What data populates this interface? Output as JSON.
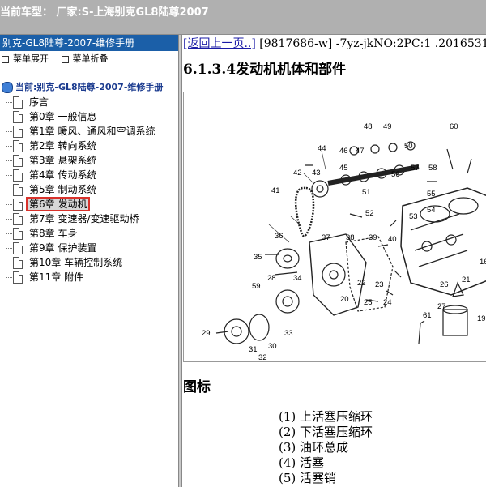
{
  "header": {
    "title": "当前车型：  厂家:S-上海别克GL8陆尊2007"
  },
  "left": {
    "bar_title": "别克-GL8陆尊-2007-维修手册",
    "tools": {
      "expand": "菜单展开",
      "collapse": "菜单折叠"
    },
    "root_label": "当前:别克-GL8陆尊-2007-维修手册",
    "items": [
      {
        "label": "序言"
      },
      {
        "label": "第0章 一般信息"
      },
      {
        "label": "第1章 暖风、通风和空调系统"
      },
      {
        "label": "第2章 转向系统"
      },
      {
        "label": "第3章 悬架系统"
      },
      {
        "label": "第4章 传动系统"
      },
      {
        "label": "第5章 制动系统"
      },
      {
        "label": "第6章 发动机"
      },
      {
        "label": "第7章 变速器/变速驱动桥"
      },
      {
        "label": "第8章 车身"
      },
      {
        "label": "第9章 保护装置"
      },
      {
        "label": "第10章 车辆控制系统"
      },
      {
        "label": "第11章 附件"
      }
    ],
    "selected_index": 7
  },
  "right": {
    "back_link": "[返回上一页..]",
    "nav_info": " [9817686-w] -7yz-jkNO:2PC:1 .20165311",
    "heading": "6.1.3.4发动机机体和部件",
    "figure_callouts": [
      "48",
      "49",
      "60",
      "46",
      "47",
      "50",
      "44",
      "45",
      "58",
      "57",
      "56",
      "42",
      "43",
      "41",
      "51",
      "55",
      "54",
      "52",
      "53",
      "36",
      "37",
      "38",
      "39",
      "40",
      "35",
      "16",
      "28",
      "34",
      "21",
      "22",
      "23",
      "24",
      "26",
      "59",
      "20",
      "25",
      "27",
      "19",
      "61",
      "29",
      "31",
      "30",
      "32",
      "33"
    ],
    "legend_title": "图标",
    "parts": [
      "(1) 上活塞压缩环",
      "(2) 下活塞压缩环",
      "(3) 油环总成",
      "(4) 活塞",
      "(5) 活塞销"
    ]
  }
}
